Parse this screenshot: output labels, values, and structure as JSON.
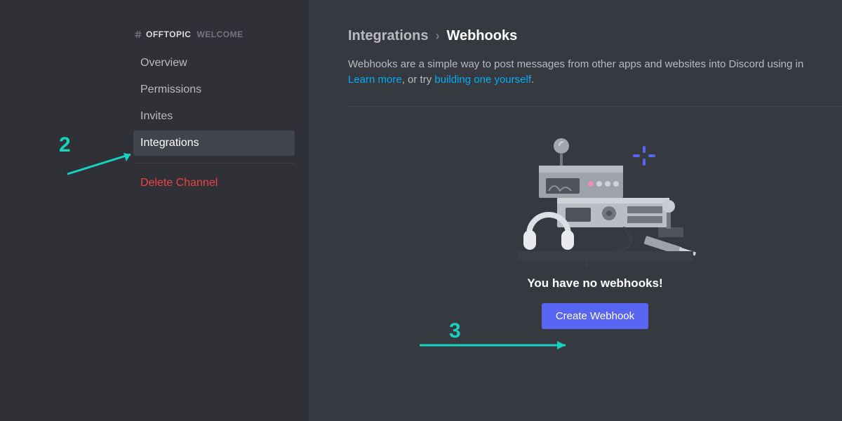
{
  "sidebar": {
    "channel_name": "OFFTOPIC",
    "section_label": "WELCOME",
    "items": [
      {
        "label": "Overview"
      },
      {
        "label": "Permissions"
      },
      {
        "label": "Invites"
      },
      {
        "label": "Integrations"
      }
    ],
    "delete_label": "Delete Channel"
  },
  "main": {
    "breadcrumb_parent": "Integrations",
    "breadcrumb_current": "Webhooks",
    "description_pre": "Webhooks are a simple way to post messages from other apps and websites into Discord using in",
    "link_learn": "Learn more",
    "description_mid": ", or try ",
    "link_build": "building one yourself",
    "description_post": ".",
    "empty_heading": "You have no webhooks!",
    "create_label": "Create Webhook"
  },
  "annotations": {
    "step2": "2",
    "step3": "3"
  }
}
